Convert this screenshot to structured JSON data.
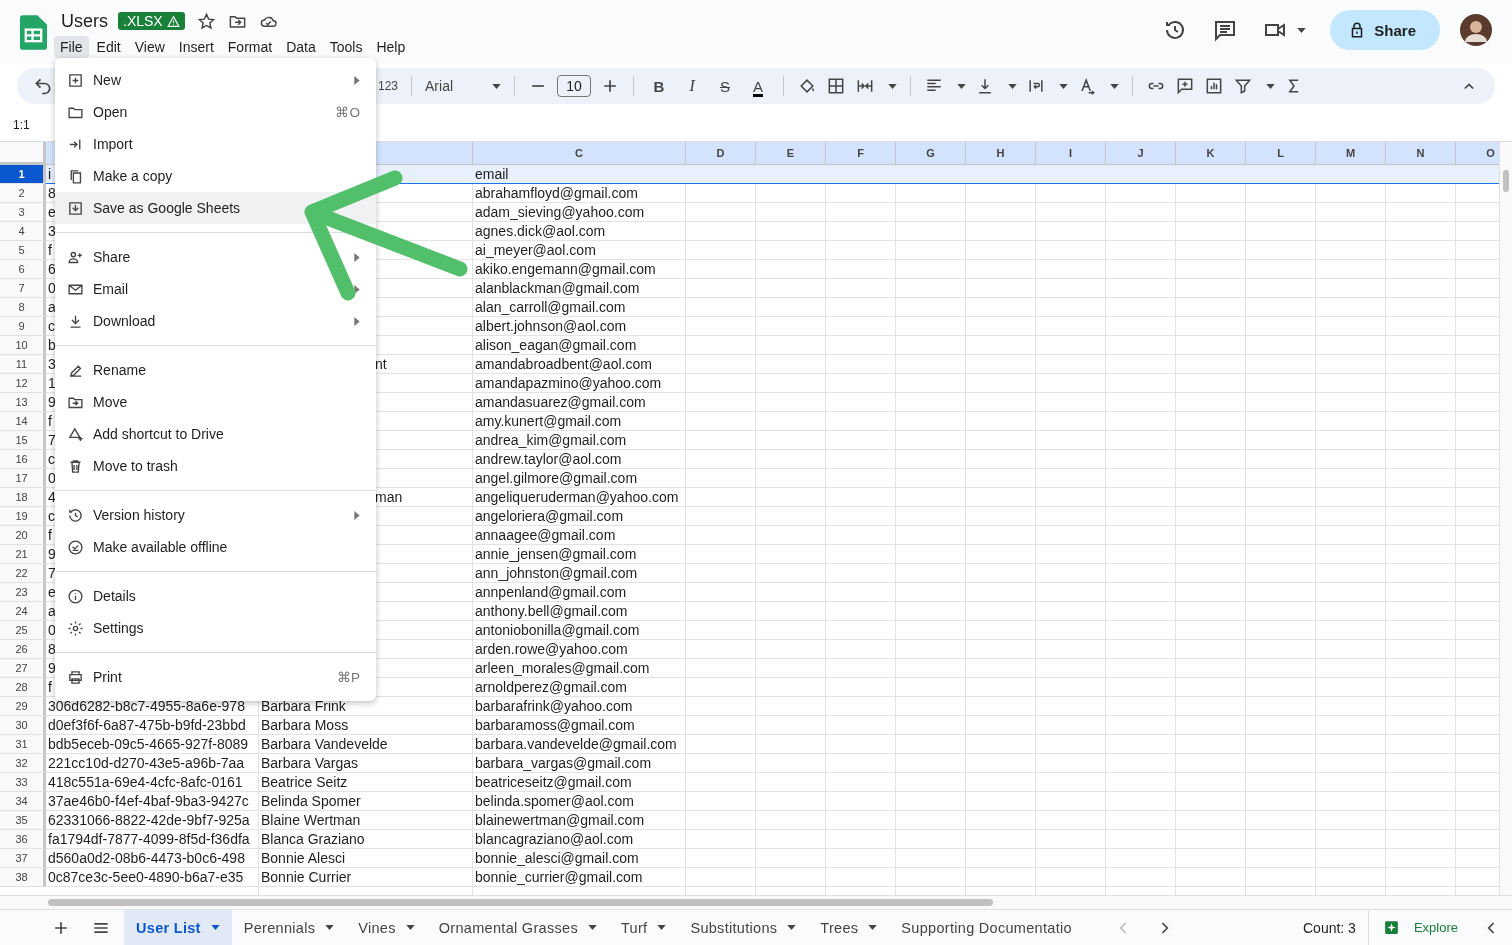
{
  "document": {
    "title": "Users",
    "badge": ".XLSX"
  },
  "menubar": [
    {
      "label": "File",
      "selected": true
    },
    {
      "label": "Edit",
      "selected": false
    },
    {
      "label": "View",
      "selected": false
    },
    {
      "label": "Insert",
      "selected": false
    },
    {
      "label": "Format",
      "selected": false
    },
    {
      "label": "Data",
      "selected": false
    },
    {
      "label": "Tools",
      "selected": false
    },
    {
      "label": "Help",
      "selected": false
    }
  ],
  "share_button": {
    "label": "Share"
  },
  "toolbar": {
    "number_format": "123",
    "font": "Arial",
    "font_size": "10",
    "format_buttons": [
      {
        "kind": "bold",
        "label": "B"
      },
      {
        "kind": "italic",
        "label": "I"
      },
      {
        "kind": "strikethrough",
        "label": "S"
      },
      {
        "kind": "text_color",
        "label": "A"
      }
    ]
  },
  "name_box": "1:1",
  "grid": {
    "columns": [
      "C",
      "D",
      "E",
      "F",
      "G",
      "H",
      "I",
      "J",
      "K",
      "L",
      "M",
      "N",
      "O"
    ],
    "rows": [
      {
        "number": "1",
        "selected": true,
        "cells": {
          "a": "i",
          "c": "email"
        }
      },
      {
        "number": "2",
        "selected": false,
        "cells": {
          "a": "8",
          "c": "abrahamfloyd@gmail.com"
        }
      },
      {
        "number": "3",
        "selected": false,
        "cells": {
          "a": "e",
          "c": "adam_sieving@yahoo.com"
        }
      },
      {
        "number": "4",
        "selected": false,
        "cells": {
          "a": "3",
          "c": "agnes.dick@aol.com"
        }
      },
      {
        "number": "5",
        "selected": false,
        "cells": {
          "a": "f",
          "c": "ai_meyer@aol.com"
        }
      },
      {
        "number": "6",
        "selected": false,
        "cells": {
          "a": "6",
          "c": "akiko.engemann@gmail.com"
        }
      },
      {
        "number": "7",
        "selected": false,
        "cells": {
          "a": "0",
          "c": "alanblackman@gmail.com"
        }
      },
      {
        "number": "8",
        "selected": false,
        "cells": {
          "a": "a",
          "c": "alan_carroll@gmail.com"
        }
      },
      {
        "number": "9",
        "selected": false,
        "cells": {
          "a": "c",
          "c": "albert.johnson@aol.com"
        }
      },
      {
        "number": "10",
        "selected": false,
        "cells": {
          "a": "b",
          "c": "alison_eagan@gmail.com"
        }
      },
      {
        "number": "11",
        "selected": false,
        "cells": {
          "a": "3",
          "b": "nt",
          "c": "amandabroadbent@aol.com"
        }
      },
      {
        "number": "12",
        "selected": false,
        "cells": {
          "a": "1",
          "c": "amandapazmino@yahoo.com"
        }
      },
      {
        "number": "13",
        "selected": false,
        "cells": {
          "a": "9",
          "c": "amandasuarez@gmail.com"
        }
      },
      {
        "number": "14",
        "selected": false,
        "cells": {
          "a": "f",
          "c": "amy.kunert@gmail.com"
        }
      },
      {
        "number": "15",
        "selected": false,
        "cells": {
          "a": "7",
          "c": "andrea_kim@gmail.com"
        }
      },
      {
        "number": "16",
        "selected": false,
        "cells": {
          "a": "c",
          "c": "andrew.taylor@aol.com"
        }
      },
      {
        "number": "17",
        "selected": false,
        "cells": {
          "a": "0",
          "c": "angel.gilmore@gmail.com"
        }
      },
      {
        "number": "18",
        "selected": false,
        "cells": {
          "a": "4",
          "b": "man",
          "c": "angeliqueruderman@yahoo.com"
        }
      },
      {
        "number": "19",
        "selected": false,
        "cells": {
          "a": "c",
          "c": "angeloriera@gmail.com"
        }
      },
      {
        "number": "20",
        "selected": false,
        "cells": {
          "a": "f",
          "c": "annaagee@gmail.com"
        }
      },
      {
        "number": "21",
        "selected": false,
        "cells": {
          "a": "9",
          "c": "annie_jensen@gmail.com"
        }
      },
      {
        "number": "22",
        "selected": false,
        "cells": {
          "a": "7",
          "c": "ann_johnston@gmail.com"
        }
      },
      {
        "number": "23",
        "selected": false,
        "cells": {
          "a": "e",
          "c": "annpenland@gmail.com"
        }
      },
      {
        "number": "24",
        "selected": false,
        "cells": {
          "a": "a",
          "c": "anthony.bell@gmail.com"
        }
      },
      {
        "number": "25",
        "selected": false,
        "cells": {
          "a": "0",
          "c": "antoniobonilla@gmail.com"
        }
      },
      {
        "number": "26",
        "selected": false,
        "cells": {
          "a": "8",
          "c": "arden.rowe@yahoo.com"
        }
      },
      {
        "number": "27",
        "selected": false,
        "cells": {
          "a": "9",
          "c": "arleen_morales@gmail.com"
        }
      },
      {
        "number": "28",
        "selected": false,
        "cells": {
          "a": "f",
          "c": "arnoldperez@gmail.com"
        }
      },
      {
        "number": "29",
        "selected": false,
        "cells": {
          "a": "306d6282-b8c7-4955-8a6e-978",
          "b": "Barbara Frink",
          "c": "barbarafrink@yahoo.com"
        }
      },
      {
        "number": "30",
        "selected": false,
        "cells": {
          "a": "d0ef3f6f-6a87-475b-b9fd-23bbd",
          "b": "Barbara Moss",
          "c": "barbaramoss@gmail.com"
        }
      },
      {
        "number": "31",
        "selected": false,
        "cells": {
          "a": "bdb5eceb-09c5-4665-927f-8089",
          "b": "Barbara Vandevelde",
          "c": "barbara.vandevelde@gmail.com"
        }
      },
      {
        "number": "32",
        "selected": false,
        "cells": {
          "a": "221cc10d-d270-43e5-a96b-7aa",
          "b": "Barbara Vargas",
          "c": "barbara_vargas@gmail.com"
        }
      },
      {
        "number": "33",
        "selected": false,
        "cells": {
          "a": "418c551a-69e4-4cfc-8afc-0161",
          "b": "Beatrice Seitz",
          "c": "beatriceseitz@gmail.com"
        }
      },
      {
        "number": "34",
        "selected": false,
        "cells": {
          "a": "37ae46b0-f4ef-4baf-9ba3-9427c",
          "b": "Belinda Spomer",
          "c": "belinda.spomer@aol.com"
        }
      },
      {
        "number": "35",
        "selected": false,
        "cells": {
          "a": "62331066-8822-42de-9bf7-925a",
          "b": "Blaine Wertman",
          "c": "blainewertman@gmail.com"
        }
      },
      {
        "number": "36",
        "selected": false,
        "cells": {
          "a": "fa1794df-7877-4099-8f5d-f36dfa",
          "b": "Blanca Graziano",
          "c": "blancagraziano@aol.com"
        }
      },
      {
        "number": "37",
        "selected": false,
        "cells": {
          "a": "d560a0d2-08b6-4473-b0c6-498",
          "b": "Bonnie Alesci",
          "c": "bonnie_alesci@gmail.com"
        }
      },
      {
        "number": "38",
        "selected": false,
        "cells": {
          "a": "0c87ce3c-5ee0-4890-b6a7-e35",
          "b": "Bonnie Currier",
          "c": "bonnie_currier@gmail.com"
        }
      }
    ]
  },
  "menu": {
    "sections": [
      {
        "items": [
          {
            "label": "New",
            "submenu": true,
            "highlighted": false
          },
          {
            "label": "Open",
            "shortcut": "⌘O",
            "submenu": false,
            "highlighted": false
          },
          {
            "label": "Import",
            "submenu": false,
            "highlighted": false
          },
          {
            "label": "Make a copy",
            "submenu": false,
            "highlighted": false
          },
          {
            "label": "Save as Google Sheets",
            "submenu": false,
            "highlighted": true
          }
        ]
      },
      {
        "items": [
          {
            "label": "Share",
            "submenu": true,
            "highlighted": false
          },
          {
            "label": "Email",
            "submenu": true,
            "highlighted": false
          },
          {
            "label": "Download",
            "submenu": true,
            "highlighted": false
          }
        ]
      },
      {
        "items": [
          {
            "label": "Rename",
            "submenu": false,
            "highlighted": false
          },
          {
            "label": "Move",
            "submenu": false,
            "highlighted": false
          },
          {
            "label": "Add shortcut to Drive",
            "submenu": false,
            "highlighted": false
          },
          {
            "label": "Move to trash",
            "submenu": false,
            "highlighted": false
          }
        ]
      },
      {
        "items": [
          {
            "label": "Version history",
            "submenu": true,
            "highlighted": false
          },
          {
            "label": "Make available offline",
            "submenu": false,
            "highlighted": false
          }
        ]
      },
      {
        "items": [
          {
            "label": "Details",
            "submenu": false,
            "highlighted": false
          },
          {
            "label": "Settings",
            "submenu": false,
            "highlighted": false
          }
        ]
      },
      {
        "items": [
          {
            "label": "Print",
            "shortcut": "⌘P",
            "submenu": false,
            "highlighted": false
          }
        ]
      }
    ]
  },
  "sheet_tabs": [
    {
      "label": "User List",
      "selected": true
    },
    {
      "label": "Perennials",
      "selected": false
    },
    {
      "label": "Vines",
      "selected": false
    },
    {
      "label": "Ornamental Grasses",
      "selected": false
    },
    {
      "label": "Turf",
      "selected": false
    },
    {
      "label": "Substitutions",
      "selected": false
    },
    {
      "label": "Trees",
      "selected": false
    },
    {
      "label": "Supporting Documentatio",
      "selected": false
    }
  ],
  "status": {
    "count": "Count: 3",
    "explore": "Explore"
  }
}
